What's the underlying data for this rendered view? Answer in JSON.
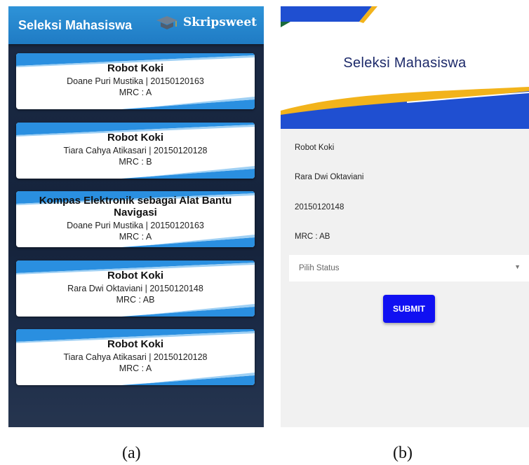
{
  "panel_a": {
    "title": "Seleksi Mahasiswa",
    "brand_name": "Skripsweet",
    "brand_icon": "graduation-cap-icon",
    "cards": [
      {
        "title": "Robot Koki",
        "student": "Doane Puri Mustika | 20150120163",
        "mrc": "MRC : A"
      },
      {
        "title": "Robot Koki",
        "student": "Tiara Cahya Atikasari | 20150120128",
        "mrc": "MRC : B"
      },
      {
        "title": "Kompas Elektronik sebagai Alat Bantu Navigasi",
        "student": "Doane Puri Mustika | 20150120163",
        "mrc": "MRC : A"
      },
      {
        "title": "Robot Koki",
        "student": "Rara Dwi Oktaviani | 20150120148",
        "mrc": "MRC : AB"
      },
      {
        "title": "Robot Koki",
        "student": "Tiara Cahya Atikasari | 20150120128",
        "mrc": "MRC : A"
      }
    ]
  },
  "panel_b": {
    "title": "Seleksi Mahasiswa",
    "topic": "Robot Koki",
    "student_name": "Rara Dwi Oktaviani",
    "student_id": "20150120148",
    "mrc": "MRC : AB",
    "status_select": {
      "placeholder": "Pilih Status"
    },
    "submit_label": "SUBMIT"
  },
  "captions": {
    "a": "(a)",
    "b": "(b)"
  },
  "colors": {
    "accent_blue": "#1f7bc4",
    "accent_yellow": "#f2b31b",
    "submit_blue": "#1010f2",
    "title_navy": "#1d2a6a"
  }
}
